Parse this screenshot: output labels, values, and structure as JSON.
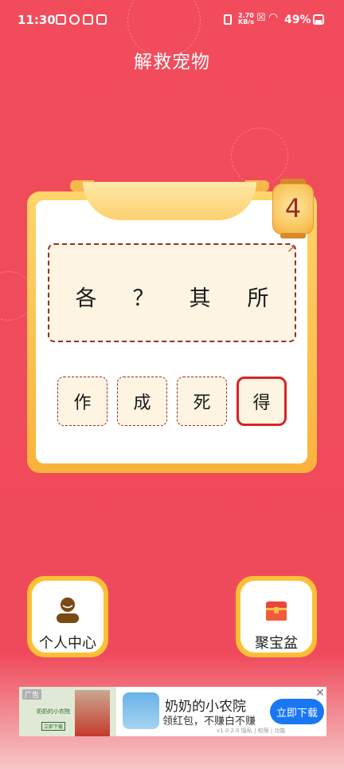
{
  "status_bar": {
    "time": "11:30",
    "net_speed_top": "2.70",
    "net_speed_bottom": "KB/s",
    "battery": "49%"
  },
  "header": {
    "title": "解救宠物"
  },
  "level": {
    "number": "4"
  },
  "idiom": {
    "chars": [
      "各",
      "？",
      "其",
      "所"
    ]
  },
  "options": [
    {
      "label": "作",
      "selected": false
    },
    {
      "label": "成",
      "selected": false
    },
    {
      "label": "死",
      "selected": false
    },
    {
      "label": "得",
      "selected": true
    }
  ],
  "buttons": {
    "profile_label": "个人中心",
    "treasure_label": "聚宝盆"
  },
  "ad": {
    "tag": "广告",
    "thumb_title": "奶奶的小农院",
    "thumb_button": "立即下载",
    "app_name": "奶奶的小农院",
    "desc": "领红包，不赚白不赚",
    "cta": "立即下载",
    "version": "v1.0.2.0  隐私 | 权限 | 功能",
    "close": "✕"
  },
  "colors": {
    "background": "#f04b5b",
    "card_border": "#ffc340",
    "selected_border": "#d82424",
    "ad_cta": "#1977f3"
  }
}
